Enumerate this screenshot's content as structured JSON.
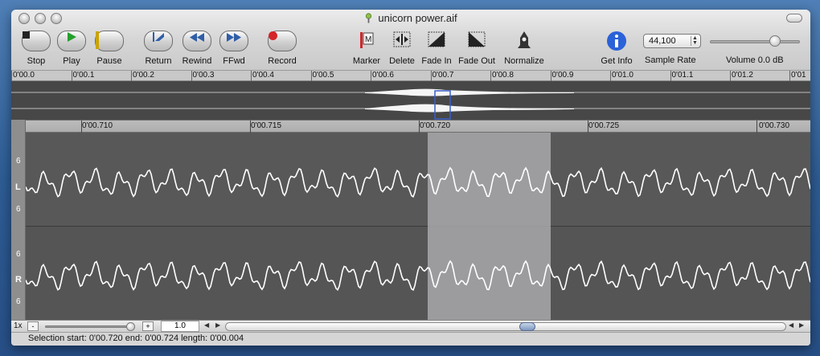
{
  "window": {
    "title": "unicorn power.aif"
  },
  "toolbar": {
    "stop": "Stop",
    "play": "Play",
    "pause": "Pause",
    "return": "Return",
    "rewind": "Rewind",
    "ffwd": "FFwd",
    "record": "Record",
    "marker": "Marker",
    "delete": "Delete",
    "fade_in": "Fade In",
    "fade_out": "Fade Out",
    "normalize": "Normalize",
    "get_info": "Get Info",
    "sample_rate_label": "Sample Rate",
    "sample_rate_value": "44,100",
    "volume_label": "Volume 0.0 dB",
    "volume_level": 0.72
  },
  "overview_ruler": [
    "0'00.0",
    "0'00.1",
    "0'00.2",
    "0'00.3",
    "0'00.4",
    "0'00.5",
    "0'00.6",
    "0'00.7",
    "0'00.8",
    "0'00.9",
    "0'01.0",
    "0'01.1",
    "0'01.2",
    "0'01"
  ],
  "detail_ruler": [
    "0'00.710",
    "0'00.715",
    "0'00.720",
    "0'00.725",
    "0'00.730"
  ],
  "channels": {
    "left": {
      "label": "L",
      "top_scale": "6",
      "bottom_scale": "6"
    },
    "right": {
      "label": "R",
      "top_scale": "6",
      "bottom_scale": "6"
    }
  },
  "zoom": {
    "level_label": "1x",
    "value": "1.0",
    "zoom_out_glyph": "-",
    "zoom_in_glyph": "+"
  },
  "status": {
    "selection": "Selection start: 0'00.720 end: 0'00.724 length: 0'00.004"
  },
  "colors": {
    "record": "#d4262a",
    "play": "#22a02a",
    "pause": "#c9a400",
    "transport_blue": "#2f5ea8",
    "info": "#2a62d8"
  }
}
